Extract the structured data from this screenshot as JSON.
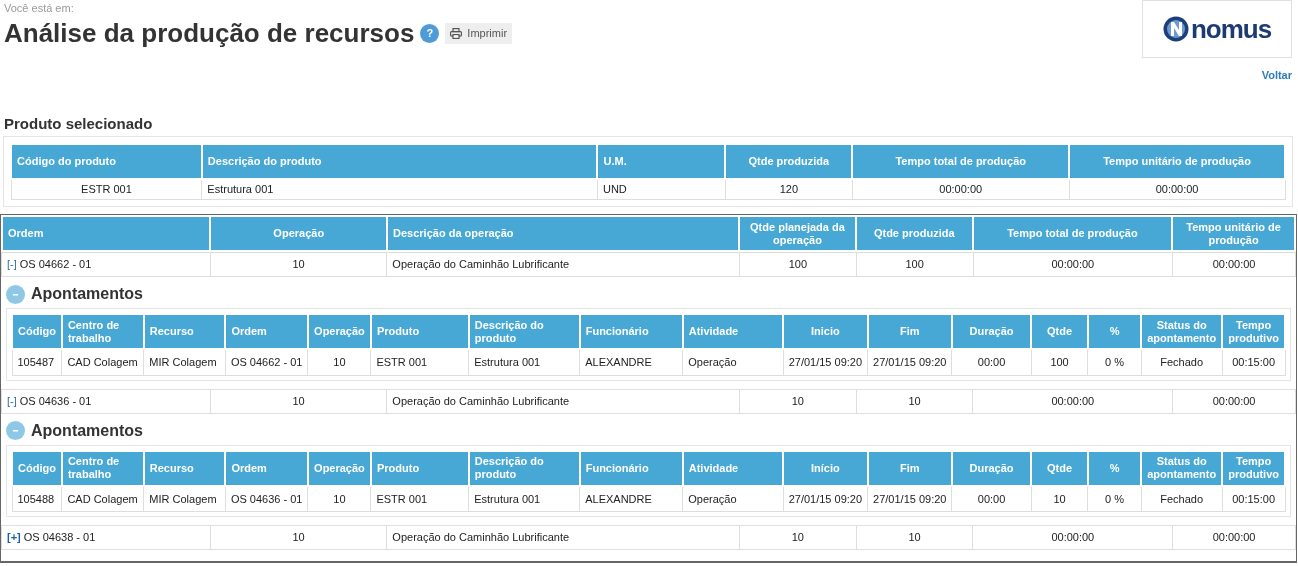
{
  "breadcrumb": "Você está em:",
  "title": "Análise da produção de recursos",
  "help": "?",
  "print_button": "Imprimir",
  "back_link": "Voltar",
  "logo": {
    "text": "nomus"
  },
  "product_section": {
    "title": "Produto selecionado",
    "columns": [
      "Código do produto",
      "Descrição do produto",
      "U.M.",
      "Qtde produzida",
      "Tempo total de produção",
      "Tempo unitário de produção"
    ],
    "rows": [
      [
        "ESTR 001",
        "Estrutura 001",
        "UND",
        "120",
        "00:00:00",
        "00:00:00"
      ]
    ]
  },
  "orders": {
    "columns": [
      "Ordem",
      "Operação",
      "Descrição da operação",
      "Qtde planejada da operação",
      "Qtde produzida",
      "Tempo total de produção",
      "Tempo unitário de produção"
    ],
    "rows": [
      {
        "toggle": "[-]",
        "expanded": true,
        "cells": [
          "OS 04662 - 01",
          "10",
          "Operação do Caminhão Lubrificante",
          "100",
          "100",
          "00:00:00",
          "00:00:00"
        ],
        "appointments": {
          "title": "Apontamentos",
          "columns": [
            "Código",
            "Centro de trabalho",
            "Recurso",
            "Ordem",
            "Operação",
            "Produto",
            "Descrição do produto",
            "Funcionário",
            "Atividade",
            "Inicio",
            "Fim",
            "Duração",
            "Qtde",
            "%",
            "Status do apontamento",
            "Tempo produtivo"
          ],
          "rows": [
            [
              "105487",
              "CAD Colagem",
              "MIR Colagem",
              "OS 04662 - 01",
              "10",
              "ESTR 001",
              "Estrutura 001",
              "ALEXANDRE",
              "Operação",
              "27/01/15 09:20",
              "27/01/15 09:20",
              "00:00",
              "100",
              "0 %",
              "Fechado",
              "00:15:00"
            ]
          ]
        }
      },
      {
        "toggle": "[-]",
        "expanded": true,
        "cells": [
          "OS 04636 - 01",
          "10",
          "Operação do Caminhão Lubrificante",
          "10",
          "10",
          "00:00:00",
          "00:00:00"
        ],
        "appointments": {
          "title": "Apontamentos",
          "columns": [
            "Código",
            "Centro de trabalho",
            "Recurso",
            "Ordem",
            "Operação",
            "Produto",
            "Descrição do produto",
            "Funcionário",
            "Atividade",
            "Início",
            "Fim",
            "Duração",
            "Qtde",
            "%",
            "Status do apontamento",
            "Tempo produtivo"
          ],
          "rows": [
            [
              "105488",
              "CAD Colagem",
              "MIR Colagem",
              "OS 04636 - 01",
              "10",
              "ESTR 001",
              "Estrutura 001",
              "ALEXANDRE",
              "Operação",
              "27/01/15 09:20",
              "27/01/15 09:20",
              "00:00",
              "10",
              "0 %",
              "Fechado",
              "00:15:00"
            ]
          ]
        }
      },
      {
        "toggle": "[+]",
        "expanded": false,
        "cells": [
          "OS 04638 - 01",
          "10",
          "Operação do Caminhão Lubrificante",
          "10",
          "10",
          "00:00:00",
          "00:00:00"
        ]
      }
    ]
  }
}
